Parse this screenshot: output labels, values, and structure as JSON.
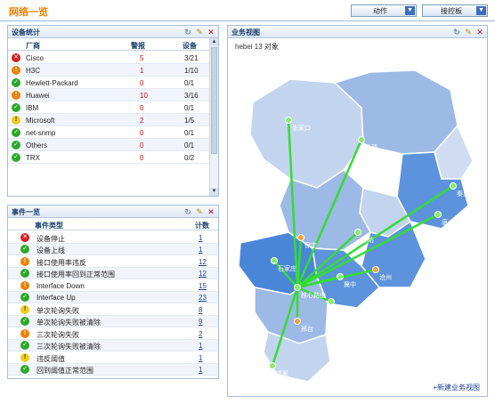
{
  "page": {
    "title": "网络一览"
  },
  "toolbar": {
    "action_label": "动作",
    "dashboard_label": "接控板"
  },
  "devices_panel": {
    "title": "设备统计",
    "headers": {
      "vendor": "厂商",
      "alarms": "警报",
      "devices": "设备"
    },
    "rows": [
      {
        "status": "critical",
        "vendor": "Cisco",
        "alarms": "5",
        "devices": "3/21"
      },
      {
        "status": "major",
        "vendor": "H3C",
        "alarms": "1",
        "devices": "1/10"
      },
      {
        "status": "ok",
        "vendor": "Hewlett-Packard",
        "alarms": "0",
        "devices": "0/1"
      },
      {
        "status": "major",
        "vendor": "Huawei",
        "alarms": "10",
        "devices": "3/16"
      },
      {
        "status": "ok",
        "vendor": "IBM",
        "alarms": "0",
        "devices": "0/1"
      },
      {
        "status": "warning",
        "vendor": "Microsoft",
        "alarms": "2",
        "devices": "1/5"
      },
      {
        "status": "ok",
        "vendor": "net-snmp",
        "alarms": "0",
        "devices": "0/1"
      },
      {
        "status": "ok",
        "vendor": "Others",
        "alarms": "0",
        "devices": "0/1"
      },
      {
        "status": "ok",
        "vendor": "TRX",
        "alarms": "0",
        "devices": "0/2"
      }
    ]
  },
  "events_panel": {
    "title": "事件一览",
    "headers": {
      "type": "事件类型",
      "count": "计数"
    },
    "rows": [
      {
        "status": "critical",
        "type": "设备停止",
        "count": "1"
      },
      {
        "status": "ok",
        "type": "设备上线",
        "count": "1"
      },
      {
        "status": "major",
        "type": "接口使用率违反",
        "count": "12"
      },
      {
        "status": "ok",
        "type": "接口使用率回到正常范围",
        "count": "12"
      },
      {
        "status": "major",
        "type": "Interface Down",
        "count": "15"
      },
      {
        "status": "ok",
        "type": "Interface Up",
        "count": "23"
      },
      {
        "status": "warning",
        "type": "单次轮询失败",
        "count": "8"
      },
      {
        "status": "ok",
        "type": "单次轮询失败被清除",
        "count": "9"
      },
      {
        "status": "major",
        "type": "三次轮询失败",
        "count": "2"
      },
      {
        "status": "ok",
        "type": "三次轮询失败被清除",
        "count": "1"
      },
      {
        "status": "warning",
        "type": "违反阈值",
        "count": "1"
      },
      {
        "status": "ok",
        "type": "回到阈值正常范围",
        "count": "1"
      }
    ]
  },
  "map_panel": {
    "title": "业务视图",
    "subtitle": "hebei 13 对象",
    "new_link": "+新建业务视图",
    "cities": [
      "张家口",
      "承德",
      "秦皇岛",
      "唐山",
      "保定",
      "廊坊",
      "石家庄",
      "衡水",
      "冀中",
      "沧州",
      "邢台",
      "邯郸",
      "核心路由"
    ]
  },
  "colors": {
    "accent": "#f08000",
    "link": "#1a3d9e",
    "map_line": "#33dd33",
    "region_light": "#c8d8f0",
    "region_mid": "#9cb8e8",
    "region_dark": "#4a86d8"
  }
}
